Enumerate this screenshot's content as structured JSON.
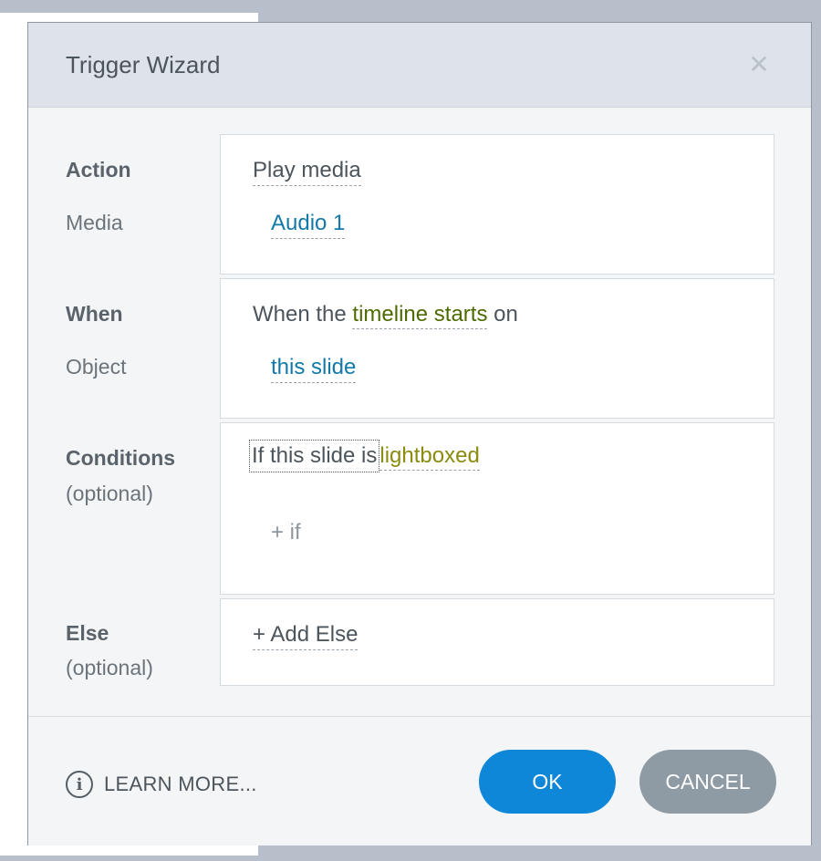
{
  "dialog": {
    "title": "Trigger Wizard",
    "close_glyph": "✕"
  },
  "action": {
    "label": "Action",
    "value": "Play media",
    "sub_label": "Media",
    "sub_value": "Audio 1"
  },
  "when": {
    "label": "When",
    "prefix": "When the",
    "event": "timeline starts",
    "suffix": "on",
    "sub_label": "Object",
    "sub_value": "this slide"
  },
  "conditions": {
    "label": "Conditions",
    "optional": "(optional)",
    "condition_prefix": "If this slide is",
    "condition_value": "lightboxed",
    "add_if": "+ if"
  },
  "else": {
    "label": "Else",
    "optional": "(optional)",
    "add_else": "+ Add Else"
  },
  "footer": {
    "info_icon_glyph": "i",
    "learn_more": "LEARN MORE...",
    "ok": "OK",
    "cancel": "CANCEL"
  },
  "colors": {
    "header_bg": "#dde3e9",
    "ok_button": "#0f87d9",
    "cancel_button": "#8e9aa4",
    "link_blue": "#1279a8",
    "event_green": "#4d6a00",
    "condition_olive": "#8b8b0e"
  },
  "icons": {
    "close": "close-icon",
    "info": "info-icon"
  }
}
